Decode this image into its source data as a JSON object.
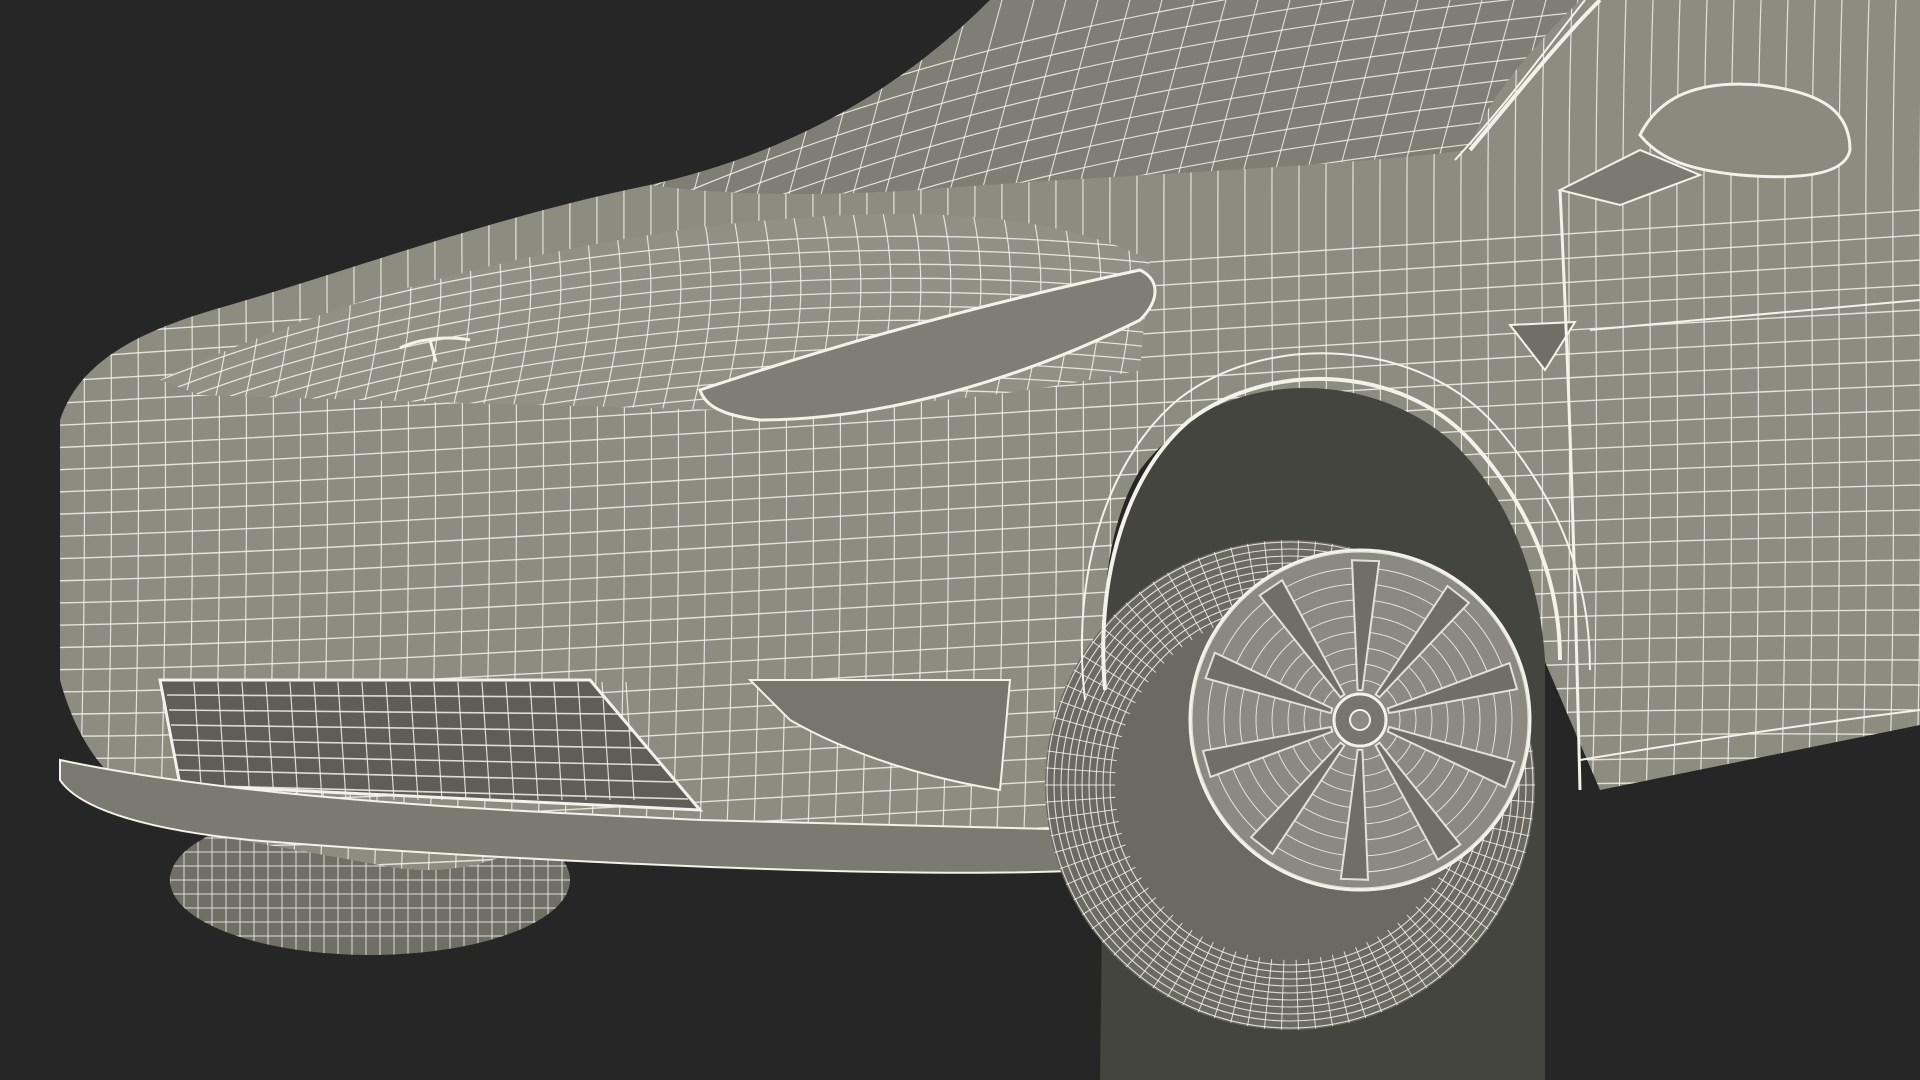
{
  "scene": {
    "subject": "car-front-wireframe-render",
    "colors": {
      "background": "#262626",
      "body": "#8c8c80",
      "body_dark": "#6f6f66",
      "body_shadow": "#55554e",
      "wire": "#f2f2ea",
      "tire": "#6a6a62",
      "rim": "#8a8a80",
      "wheel_well": "#3f3f3a",
      "glass": "#77776d"
    }
  }
}
